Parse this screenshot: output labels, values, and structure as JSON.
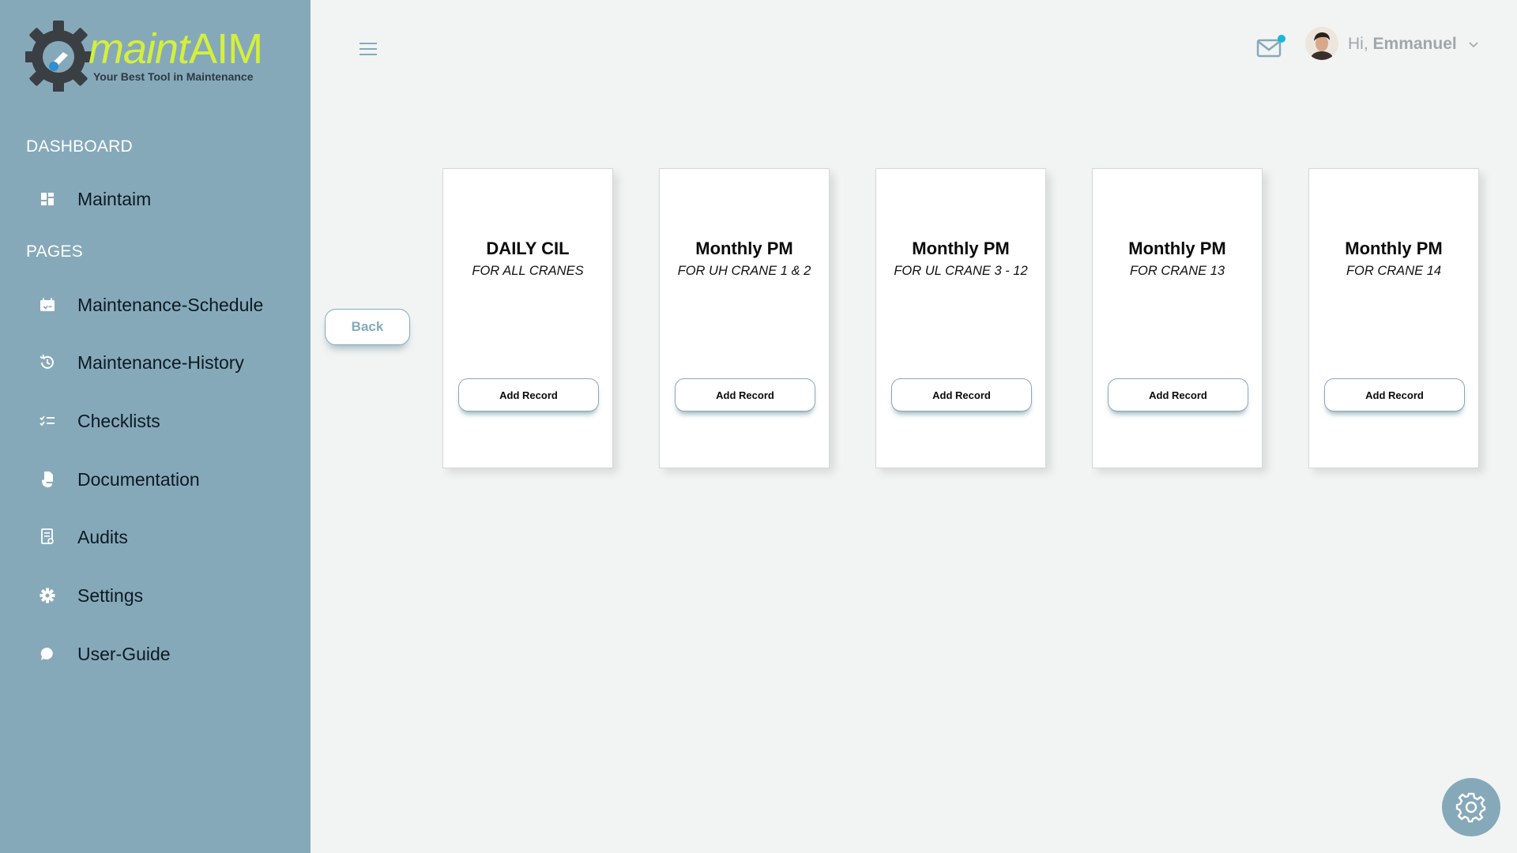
{
  "brand": {
    "word_part1": "maint",
    "word_part2": "AIM",
    "tagline": "Your Best Tool in Maintenance",
    "accent_color": "#d4ef3c"
  },
  "sidebar": {
    "bg_color": "#86a9ba",
    "sections": {
      "dashboard": "DASHBOARD",
      "pages": "PAGES"
    },
    "dashboard_items": [
      {
        "label": "Maintaim",
        "icon": "dashboard-grid-icon"
      }
    ],
    "page_items": [
      {
        "label": "Maintenance-Schedule",
        "icon": "calendar-check-icon"
      },
      {
        "label": "Maintenance-History",
        "icon": "history-icon"
      },
      {
        "label": "Checklists",
        "icon": "checklist-icon"
      },
      {
        "label": "Documentation",
        "icon": "document-hand-icon"
      },
      {
        "label": "Audits",
        "icon": "audit-report-icon"
      },
      {
        "label": "Settings",
        "icon": "gear-icon"
      },
      {
        "label": "User-Guide",
        "icon": "chat-bubble-icon"
      }
    ]
  },
  "header": {
    "menu_icon": "hamburger-icon",
    "mail_icon": "mail-icon",
    "notification_dot_color": "#17b8d8",
    "greeting_prefix": "Hi,",
    "user_name": "Emmanuel",
    "caret_icon": "chevron-down-icon"
  },
  "back_button": {
    "label": "Back"
  },
  "cards": [
    {
      "title": "DAILY CIL",
      "subtitle": "FOR ALL CRANES",
      "button": "Add Record"
    },
    {
      "title": "Monthly PM",
      "subtitle": "FOR UH CRANE 1 & 2",
      "button": "Add Record"
    },
    {
      "title": "Monthly PM",
      "subtitle": "FOR UL CRANE 3 - 12",
      "button": "Add Record"
    },
    {
      "title": "Monthly PM",
      "subtitle": "FOR CRANE 13",
      "button": "Add Record"
    },
    {
      "title": "Monthly PM",
      "subtitle": "FOR CRANE 14",
      "button": "Add Record"
    }
  ],
  "fab": {
    "icon": "gear-icon"
  }
}
